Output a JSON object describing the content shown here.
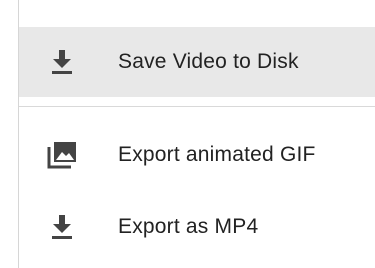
{
  "menu": {
    "items": [
      {
        "label": "Save Video to Disk",
        "icon": "download-icon",
        "highlighted": true
      },
      {
        "label": "Export animated GIF",
        "icon": "image-stack-icon",
        "highlighted": false
      },
      {
        "label": "Export as MP4",
        "icon": "download-icon",
        "highlighted": false
      }
    ]
  },
  "colors": {
    "highlight": "#e8e8e8",
    "text": "#222222",
    "icon": "#444444",
    "divider": "#d9d9d9"
  }
}
